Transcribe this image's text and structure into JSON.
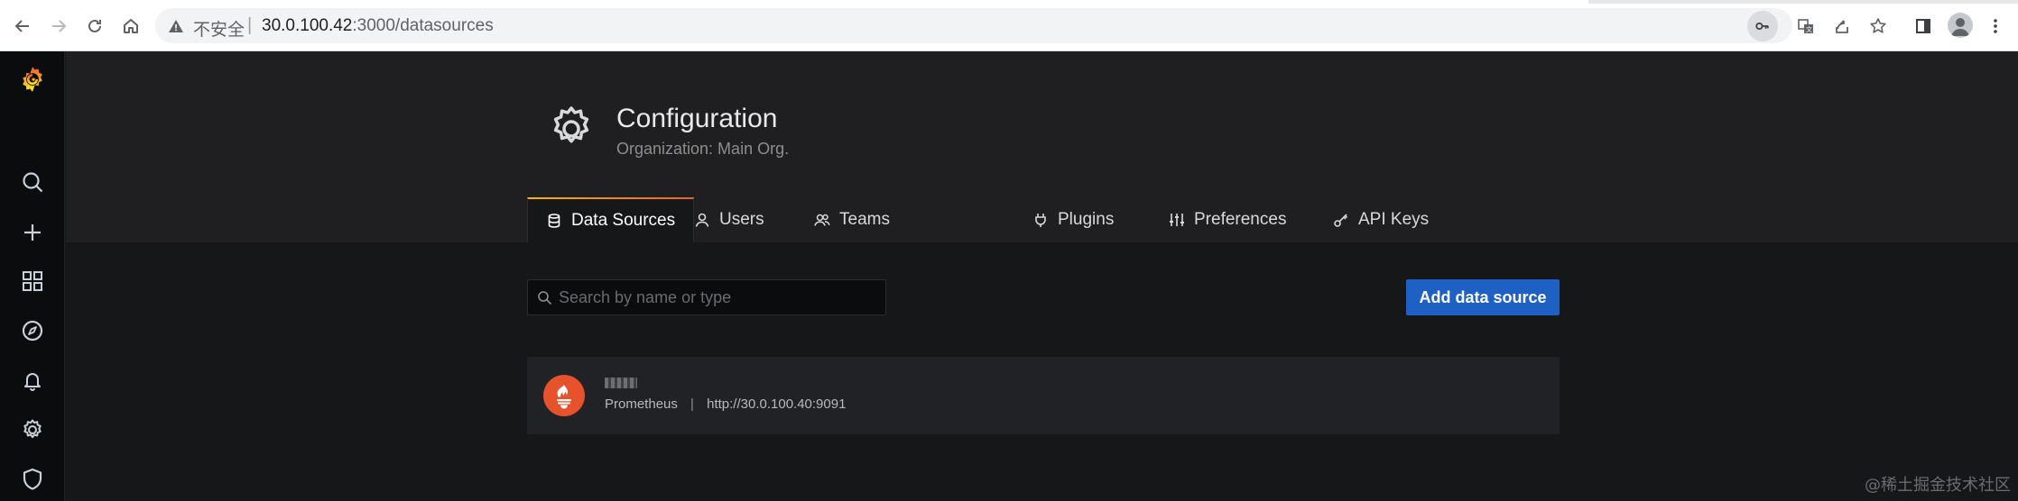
{
  "browser": {
    "security_label": "不安全",
    "separator": "|",
    "url_host": "30.0.100.42",
    "url_path": ":3000/datasources"
  },
  "sidebar": {
    "items": [
      {
        "icon": "grafana-logo-icon"
      },
      {
        "icon": "search-icon"
      },
      {
        "icon": "plus-icon"
      },
      {
        "icon": "dashboards-icon"
      },
      {
        "icon": "compass-icon"
      },
      {
        "icon": "bell-icon"
      },
      {
        "icon": "gear-icon"
      },
      {
        "icon": "shield-icon"
      }
    ]
  },
  "header": {
    "title": "Configuration",
    "subtitle": "Organization: Main Org."
  },
  "tabs": [
    {
      "label": "Data Sources",
      "icon": "database-icon",
      "active": true
    },
    {
      "label": "Users",
      "icon": "user-icon",
      "active": false
    },
    {
      "label": "Teams",
      "icon": "users-icon",
      "active": false
    },
    {
      "label": "Plugins",
      "icon": "plug-icon",
      "active": false
    },
    {
      "label": "Preferences",
      "icon": "sliders-icon",
      "active": false
    },
    {
      "label": "API Keys",
      "icon": "key-icon",
      "active": false
    }
  ],
  "search": {
    "placeholder": "Search by name or type",
    "value": ""
  },
  "actions": {
    "add_label": "Add data source"
  },
  "datasources": [
    {
      "type": "Prometheus",
      "separator": "|",
      "url": "http://30.0.100.40:9091",
      "icon": "prometheus-icon"
    }
  ],
  "watermark": "@稀土掘金技术社区",
  "colors": {
    "accent_orange": "#f79520",
    "primary_blue": "#1f60c4",
    "prometheus_red": "#e6522c",
    "background": "#161719",
    "header_bg": "#1f1f21"
  }
}
